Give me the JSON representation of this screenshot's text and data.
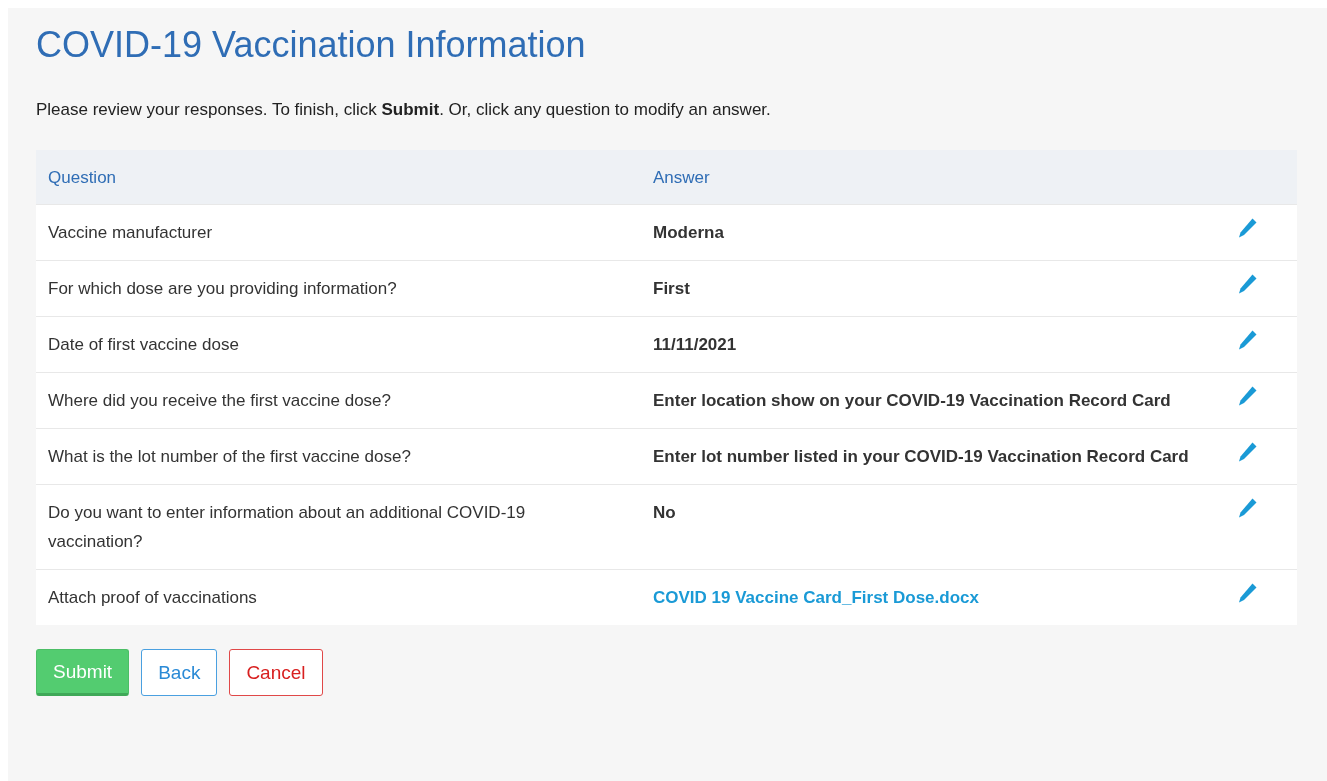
{
  "title": "COVID-19 Vaccination Information",
  "intro": "Please review your responses. To finish, click **Submit**. Or, click any question to modify an answer.",
  "table": {
    "columns": [
      "Question",
      "Answer"
    ],
    "rows": [
      {
        "question": "Vaccine manufacturer",
        "answer": "Moderna",
        "kind": "text"
      },
      {
        "question": "For which dose are you providing information?",
        "answer": "First",
        "kind": "text"
      },
      {
        "question": "Date of first vaccine dose",
        "answer": "11/11/2021",
        "kind": "text"
      },
      {
        "question": "Where did you receive the first vaccine dose?",
        "answer": "Enter location show on your COVID-19 Vaccination Record Card",
        "kind": "text"
      },
      {
        "question": "What is the lot number of the first vaccine dose?",
        "answer": "Enter lot number listed in your COVID-19 Vaccination Record Card",
        "kind": "text"
      },
      {
        "question": "Do you want to enter information about an additional COVID-19 vaccination?",
        "answer": "No",
        "kind": "text"
      },
      {
        "question": "Attach proof of vaccinations",
        "answer": "COVID 19 Vaccine Card_First Dose.docx",
        "kind": "link"
      }
    ]
  },
  "buttons": [
    {
      "label": "Submit",
      "kind": "primary"
    },
    {
      "label": "Back",
      "kind": "secondary"
    },
    {
      "label": "Cancel",
      "kind": "danger"
    }
  ]
}
